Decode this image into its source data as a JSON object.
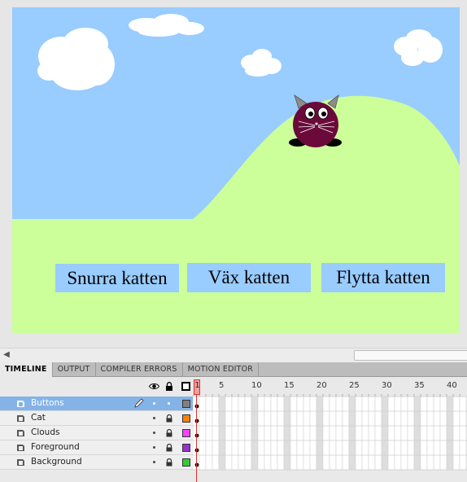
{
  "stage": {
    "buttons": [
      {
        "label": "Snurra katten"
      },
      {
        "label": "Väx katten"
      },
      {
        "label": "Flytta katten"
      }
    ],
    "colors": {
      "sky": "#99ccff",
      "hill": "#ccff99",
      "button_bg": "#99ccff",
      "cat_body": "#6b0a3a",
      "stage_border": "#e6e6e6"
    }
  },
  "panel_tabs": [
    {
      "label": "TIMELINE",
      "active": true
    },
    {
      "label": "OUTPUT",
      "active": false
    },
    {
      "label": "COMPILER ERRORS",
      "active": false
    },
    {
      "label": "MOTION EDITOR",
      "active": false
    }
  ],
  "timeline": {
    "header_icons": [
      "eye-icon",
      "lock-icon",
      "outline-icon"
    ],
    "frame_numbers": [
      "5",
      "10",
      "15",
      "20",
      "25",
      "30",
      "35",
      "40"
    ],
    "playhead_frame": "1",
    "layers": [
      {
        "name": "Buttons",
        "selected": true,
        "locked": false,
        "color": "#808080"
      },
      {
        "name": "Cat",
        "selected": false,
        "locked": true,
        "color": "#ff8000"
      },
      {
        "name": "Clouds",
        "selected": false,
        "locked": true,
        "color": "#ff40ff"
      },
      {
        "name": "Foreground",
        "selected": false,
        "locked": true,
        "color": "#9933cc"
      },
      {
        "name": "Background",
        "selected": false,
        "locked": true,
        "color": "#33cc33"
      }
    ]
  }
}
